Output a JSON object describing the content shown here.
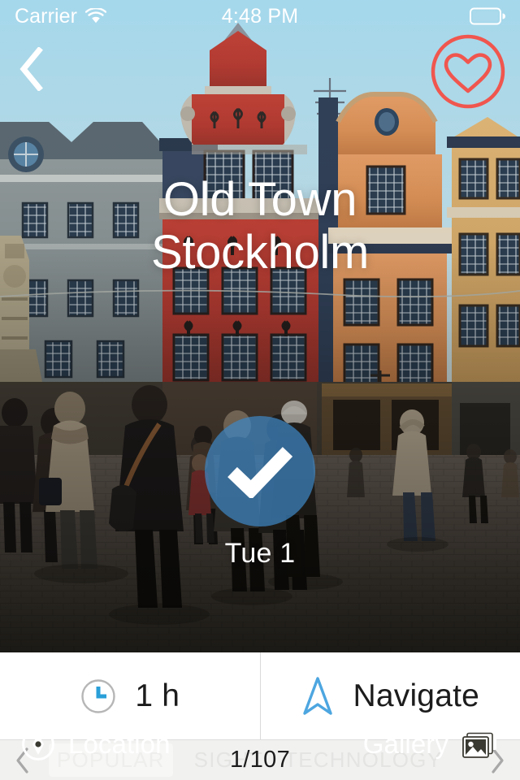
{
  "status_bar": {
    "carrier": "Carrier",
    "wifi_icon": "wifi-icon",
    "time": "4:48 PM",
    "battery_icon": "battery-icon"
  },
  "nav": {
    "back_icon": "chevron-left-icon",
    "favorite_icon": "heart-outline-icon",
    "favorite_color": "#F0564E"
  },
  "hero": {
    "title_line1": "Old Town",
    "title_line2": "Stockholm",
    "photo_alt": "Stortorget square Old Town Stockholm"
  },
  "check_badge": {
    "check_icon": "checkmark-icon",
    "day_label": "Tue 1",
    "circle_color": "#3F86C4"
  },
  "hero_actions": {
    "location": {
      "label": "Location",
      "icon": "compass-icon"
    },
    "gallery": {
      "label": "Gallery",
      "icon": "photo-stack-icon"
    }
  },
  "action_bar": {
    "duration": {
      "label": "1 h",
      "icon": "clock-icon",
      "icon_color": "#2A9FD8"
    },
    "navigate": {
      "label": "Navigate",
      "icon": "navigation-arrow-icon",
      "icon_color": "#4DA6E0"
    }
  },
  "pager": {
    "prev_icon": "chevron-left-icon",
    "next_icon": "chevron-right-icon",
    "count": "1/107",
    "ghost_tags": [
      "POPULAR",
      "SIGHT",
      "TECHNOLOGY"
    ]
  }
}
